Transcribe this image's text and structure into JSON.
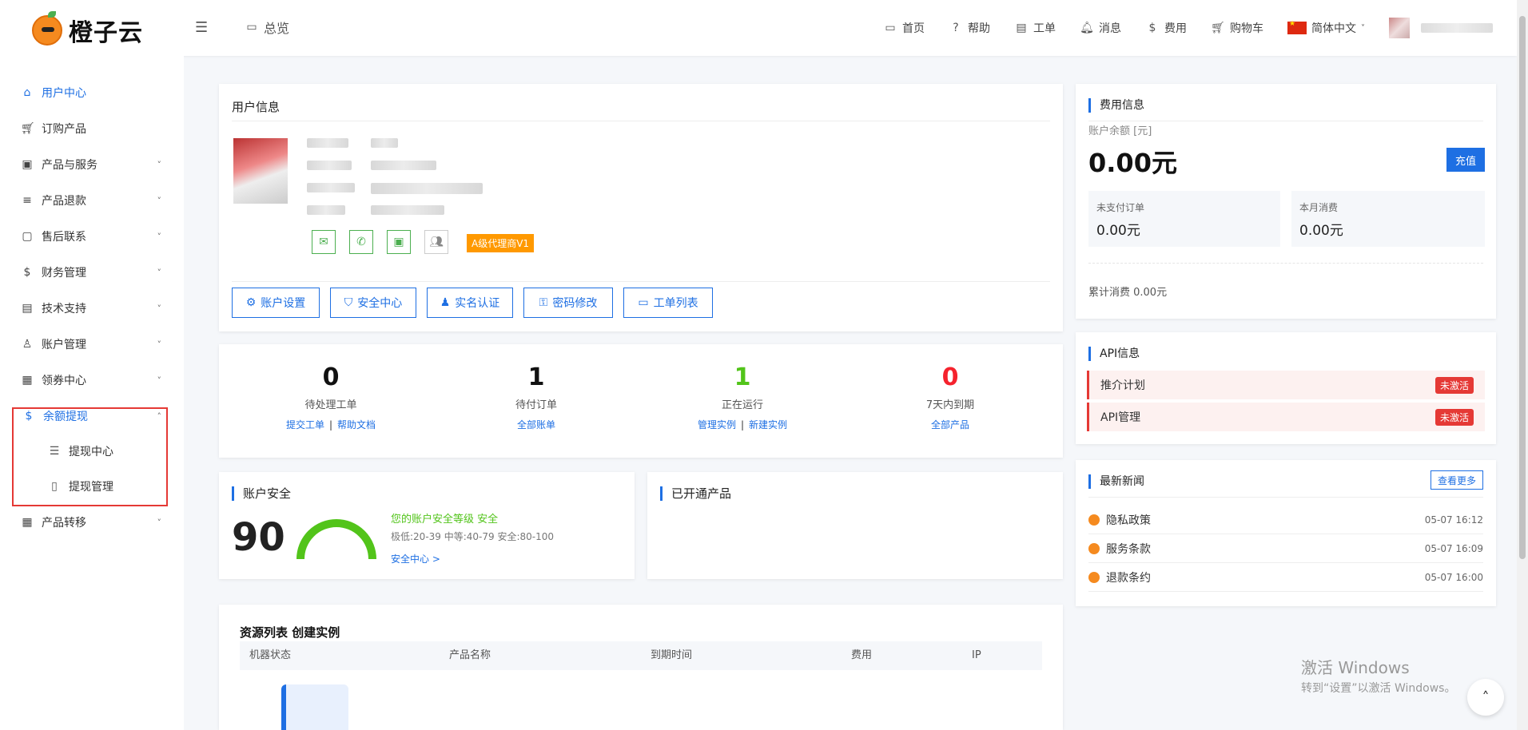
{
  "brand": {
    "name": "橙子云"
  },
  "header": {
    "overview_label": "总览",
    "nav": [
      {
        "label": "首页",
        "icon": "monitor-icon"
      },
      {
        "label": "帮助",
        "icon": "help-icon"
      },
      {
        "label": "工单",
        "icon": "ticket-icon"
      },
      {
        "label": "消息",
        "icon": "bell-icon"
      },
      {
        "label": "费用",
        "icon": "dollar-icon"
      },
      {
        "label": "购物车",
        "icon": "cart-icon"
      }
    ],
    "language": "简体中文"
  },
  "sidebar": {
    "items": [
      {
        "label": "用户中心",
        "icon": "home-icon",
        "active": true
      },
      {
        "label": "订购产品",
        "icon": "cart-icon"
      },
      {
        "label": "产品与服务",
        "icon": "briefcase-icon"
      },
      {
        "label": "产品退款",
        "icon": "sliders-icon"
      },
      {
        "label": "售后联系",
        "icon": "chat-icon"
      },
      {
        "label": "财务管理",
        "icon": "dollar-icon"
      },
      {
        "label": "技术支持",
        "icon": "document-icon"
      },
      {
        "label": "账户管理",
        "icon": "user-icon"
      },
      {
        "label": "领券中心",
        "icon": "calendar-icon"
      },
      {
        "label": "余额提现",
        "icon": "dollar-icon"
      },
      {
        "label": "产品转移",
        "icon": "grid-icon"
      }
    ],
    "subitems": [
      {
        "label": "提现中心",
        "icon": "list-icon"
      },
      {
        "label": "提现管理",
        "icon": "file-icon"
      }
    ]
  },
  "user_info": {
    "title": "用户信息",
    "agent_badge": "A级代理商V1",
    "buttons": [
      "账户设置",
      "安全中心",
      "实名认证",
      "密码修改",
      "工单列表"
    ]
  },
  "stats": [
    {
      "value": "0",
      "label": "待处理工单",
      "links": [
        "提交工单",
        "帮助文档"
      ],
      "color": "#111111"
    },
    {
      "value": "1",
      "label": "待付订单",
      "links": [
        "全部账单"
      ],
      "color": "#111111"
    },
    {
      "value": "1",
      "label": "正在运行",
      "links": [
        "管理实例",
        "新建实例"
      ],
      "color": "#52c41a"
    },
    {
      "value": "0",
      "label": "7天内到期",
      "links": [
        "全部产品"
      ],
      "color": "#f5222d"
    }
  ],
  "security": {
    "title": "账户安全",
    "score": "90",
    "level_text": "您的账户安全等级 安全",
    "range_text": "极低:20-39 中等:40-79 安全:80-100",
    "link": "安全中心 >"
  },
  "products": {
    "title": "已开通产品"
  },
  "resources": {
    "title": "资源列表 创建实例",
    "columns": [
      "机器状态",
      "产品名称",
      "到期时间",
      "费用",
      "IP"
    ]
  },
  "fees": {
    "title": "费用信息",
    "balance_label": "账户余额 [元]",
    "balance": "0.00元",
    "recharge": "充值",
    "unpaid_label": "未支付订单",
    "unpaid": "0.00元",
    "month_label": "本月消费",
    "month": "0.00元",
    "total": "累计消费 0.00元"
  },
  "api": {
    "title": "API信息",
    "rows": [
      {
        "label": "推介计划",
        "status": "未激活"
      },
      {
        "label": "API管理",
        "status": "未激活"
      }
    ]
  },
  "news": {
    "title": "最新新闻",
    "more": "查看更多",
    "items": [
      {
        "title": "隐私政策",
        "time": "05-07 16:12"
      },
      {
        "title": "服务条款",
        "time": "05-07 16:09"
      },
      {
        "title": "退款条约",
        "time": "05-07 16:00"
      }
    ]
  },
  "watermark": {
    "line1": "激活 Windows",
    "line2": "转到“设置”以激活 Windows。"
  },
  "colors": {
    "primary": "#1e6fe3",
    "success": "#52c41a",
    "danger": "#f5222d",
    "brand": "#f58a1f",
    "badge": "#ff9900"
  }
}
